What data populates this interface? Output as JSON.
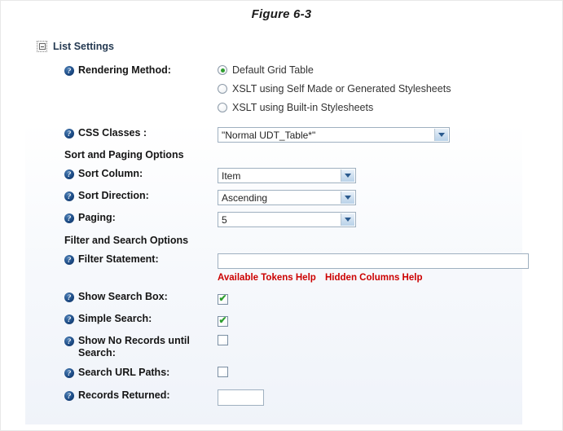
{
  "figure": {
    "title": "Figure 6-3"
  },
  "section": {
    "title": "List Settings",
    "collapse_icon": "collapse-box-icon"
  },
  "icons": {
    "help": "help-question-icon",
    "chevron_down": "chevron-down-icon",
    "check": "✔"
  },
  "colors": {
    "help_icon": "#1d4c86",
    "radio_selected": "#2f9e2f",
    "checkbox_check": "#2f9e2f",
    "help_link": "#cc0000",
    "section_title": "#253a52",
    "select_border": "#9fb0c0"
  },
  "fields": {
    "rendering_method": {
      "label": "Rendering Method:",
      "options": [
        {
          "label": "Default Grid Table",
          "selected": true
        },
        {
          "label": "XSLT using Self Made or Generated Stylesheets",
          "selected": false
        },
        {
          "label": "XSLT using Built-in Stylesheets",
          "selected": false
        }
      ]
    },
    "css_classes": {
      "label": "CSS Classes :",
      "value": "\"Normal UDT_Table*\""
    },
    "sort_paging_group": "Sort and Paging Options",
    "sort_column": {
      "label": "Sort Column:",
      "value": "Item"
    },
    "sort_direction": {
      "label": "Sort Direction:",
      "value": "Ascending"
    },
    "paging": {
      "label": "Paging:",
      "value": "5"
    },
    "filter_search_group": "Filter and Search Options",
    "filter_statement": {
      "label": "Filter Statement:",
      "value": "",
      "placeholder": ""
    },
    "help_links": {
      "tokens": "Available Tokens Help",
      "hidden_columns": "Hidden Columns Help"
    },
    "show_search_box": {
      "label": "Show Search Box:",
      "checked": true
    },
    "simple_search": {
      "label": "Simple Search:",
      "checked": true
    },
    "show_no_records": {
      "label": "Show No Records until Search:",
      "checked": false
    },
    "search_url_paths": {
      "label": "Search URL Paths:",
      "checked": false
    },
    "records_returned": {
      "label": "Records Returned:",
      "value": "",
      "placeholder": ""
    }
  }
}
